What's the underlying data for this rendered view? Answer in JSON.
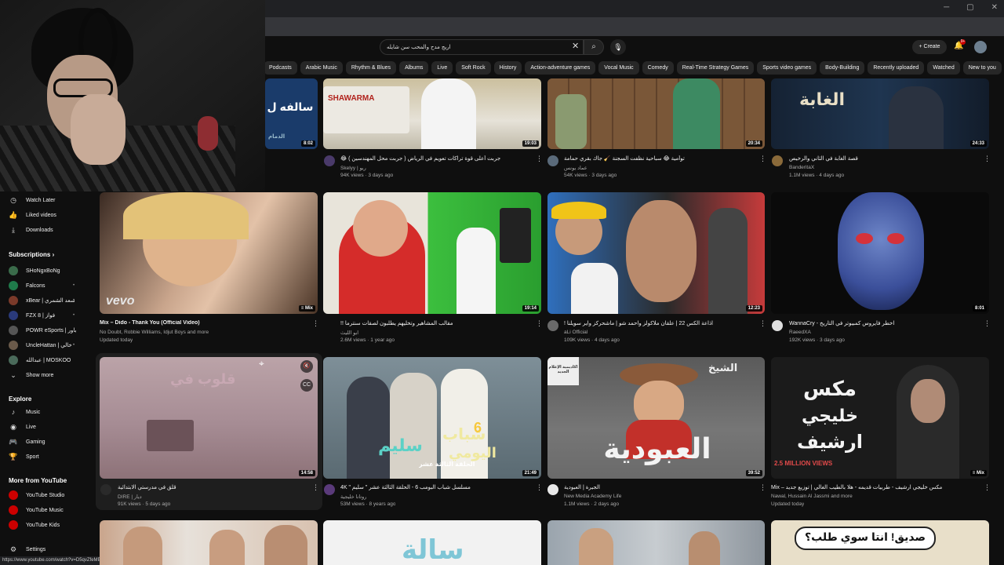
{
  "browser": {
    "status_url": "https://www.youtube.com/watch?v=D5qvZfeMEIg"
  },
  "masthead": {
    "search_value": "اريج مدح والمحب سن شايله",
    "create_label": "Create",
    "notif_count": "9+"
  },
  "chips": [
    "Podcasts",
    "Arabic Music",
    "Rhythm & Blues",
    "Albums",
    "Live",
    "Soft Rock",
    "History",
    "Action-adventure games",
    "Vocal Music",
    "Comedy",
    "Real-Time Strategy Games",
    "Sports video games",
    "Body-Building",
    "Recently uploaded",
    "Watched",
    "New to you"
  ],
  "sidebar": {
    "watch_later": "Watch Later",
    "liked": "Liked videos",
    "downloads": "Downloads",
    "subs_heading": "Subscriptions",
    "subscriptions": [
      "SHoNgxBoNg",
      "Falcons",
      "xBear | سعد الشمري",
      "FZX 8 | فواز",
      "POWR eSports | باور",
      "UncleHattan | خالي",
      "عبدالله | MOSKOO"
    ],
    "show_more": "Show more",
    "explore_heading": "Explore",
    "explore": [
      "Music",
      "Live",
      "Gaming",
      "Sport"
    ],
    "more_heading": "More from YouTube",
    "more": [
      "YouTube Studio",
      "YouTube Music",
      "YouTube Kids"
    ],
    "settings": "Settings"
  },
  "videos": {
    "r1": [
      {
        "duration": "8:02",
        "title": "",
        "channel": "",
        "meta": ""
      },
      {
        "duration": "19:03",
        "title": "جربت أعلى قوة تراكات تعويم في الرياض ( جربت محل المهندسين ) 😂",
        "channel": "Skelyy | ريو",
        "meta": "94K views · 3 days ago"
      },
      {
        "duration": "20:34",
        "title": "توأمية 😂 سباحية نظفت السجنة 🧹 جاك بقري حمامة",
        "channel": "عماد يونس",
        "meta": "54K views · 3 days ago"
      },
      {
        "duration": "24:33",
        "title": "قصة الغابة في الثاني والرخيص",
        "channel": "BanderitaX",
        "meta": "1.1M views · 4 days ago"
      }
    ],
    "r2": [
      {
        "duration": "Mix",
        "title": "Mix – Dido - Thank You (Official Video)",
        "channel": "No Doubt, Robbie Williams, Idjut Boys and more",
        "meta": "Updated today"
      },
      {
        "duration": "19:14",
        "title": "مقالب المشاهير وتخليهم يطلبون لصقات سنترما !!",
        "channel": "ابو الليث",
        "meta": "2.6M views · 1 year ago"
      },
      {
        "duration": "12:23",
        "title": "اذاعة الكس 22 | علقان ملاكولز واحمد شو | ماشحركز واير سويلنا !",
        "channel": "aLi Official",
        "meta": "109K views · 4 days ago"
      },
      {
        "duration": "8:01",
        "title": "WannaCry - اخطر فايروس كمبيوتر في التاريخ",
        "channel": "RaeedXA",
        "meta": "192K views · 3 days ago"
      }
    ],
    "r3": [
      {
        "duration": "14:58",
        "title": "قلق في مدرستي الابتدائية",
        "channel": "DIRE | ديار",
        "meta": "91K views · 5 days ago"
      },
      {
        "duration": "21:49",
        "title": "مسلسل شباب البومب 6 - الحلقة الثالثة عشر \" سليم \" 4K",
        "channel": "روتانا خليجية",
        "meta": "53M views · 8 years ago"
      },
      {
        "duration": "39:52",
        "title": "الجيرة | العبودية",
        "channel": "New Media Academy Life",
        "meta": "1.1M views · 2 days ago"
      },
      {
        "duration": "Mix",
        "title": "Mix – مكس خليجي ارشيف - طربيات قديمه - هلا بالطيب الغالي | توزيع جديد",
        "channel": "Nawal, Hussain Al Jassmi and more",
        "meta": "Updated today"
      }
    ]
  },
  "thumb_text": {
    "t1_partial": "سالفه ل",
    "t1_tag": "الدمام",
    "shawarma": "SHAWARMA",
    "forest": "الغابة",
    "vevo": "vevo",
    "school": "قلوب في",
    "shabab_a": "شباب",
    "shabab_b": "سليم",
    "shabab_c": "اليومي",
    "shabab_num": "6",
    "shabab_ep": "الحلقة الثالثة عشر",
    "sheikh": "الشيخ",
    "abudiya": "العبودية",
    "nma_badge": "أكاديمية الإعلام الجديد",
    "mix_a": "مكس",
    "mix_b": "خليجي",
    "mix_c": "ارشيف",
    "million": "2.5 MILLION VIEWS",
    "r4_speech": "صديق! انتا سوي طلب؟",
    "r4_partial": "سالة"
  }
}
